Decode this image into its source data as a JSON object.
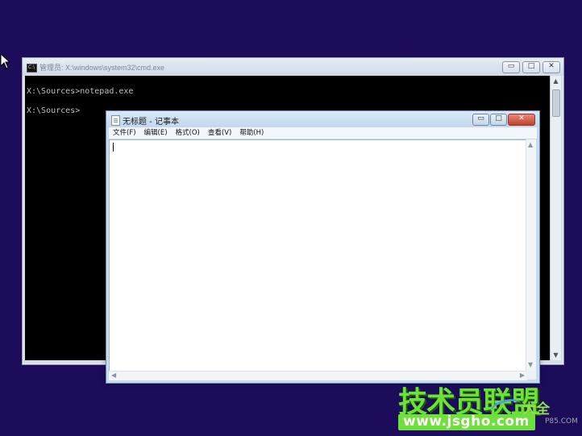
{
  "desktop": {
    "background": "#1c0c5a"
  },
  "cmd": {
    "icon_text": "C:\\",
    "title": "管理员: X:\\windows\\system32\\cmd.exe",
    "lines": [
      "X:\\Sources>notepad.exe",
      "X:\\Sources>"
    ],
    "buttons": {
      "minimize": "▭",
      "maximize": "□",
      "close": "✕"
    },
    "scroll_up": "▲",
    "scroll_down": "▼"
  },
  "notepad": {
    "title": "无标题 - 记事本",
    "menus": [
      "文件(F)",
      "编辑(E)",
      "格式(O)",
      "查看(V)",
      "帮助(H)"
    ],
    "buttons": {
      "minimize": "▭",
      "maximize": "□",
      "close": "✕"
    },
    "scroll": {
      "up": "▲",
      "down": "▼",
      "left": "◀",
      "right": "▶"
    },
    "content": ""
  },
  "watermark": {
    "brand": "技术员联盟",
    "url": "www.jsgho.com",
    "side": "大全",
    "side_small": "P85.COM",
    "accent": "#6fe03a"
  }
}
